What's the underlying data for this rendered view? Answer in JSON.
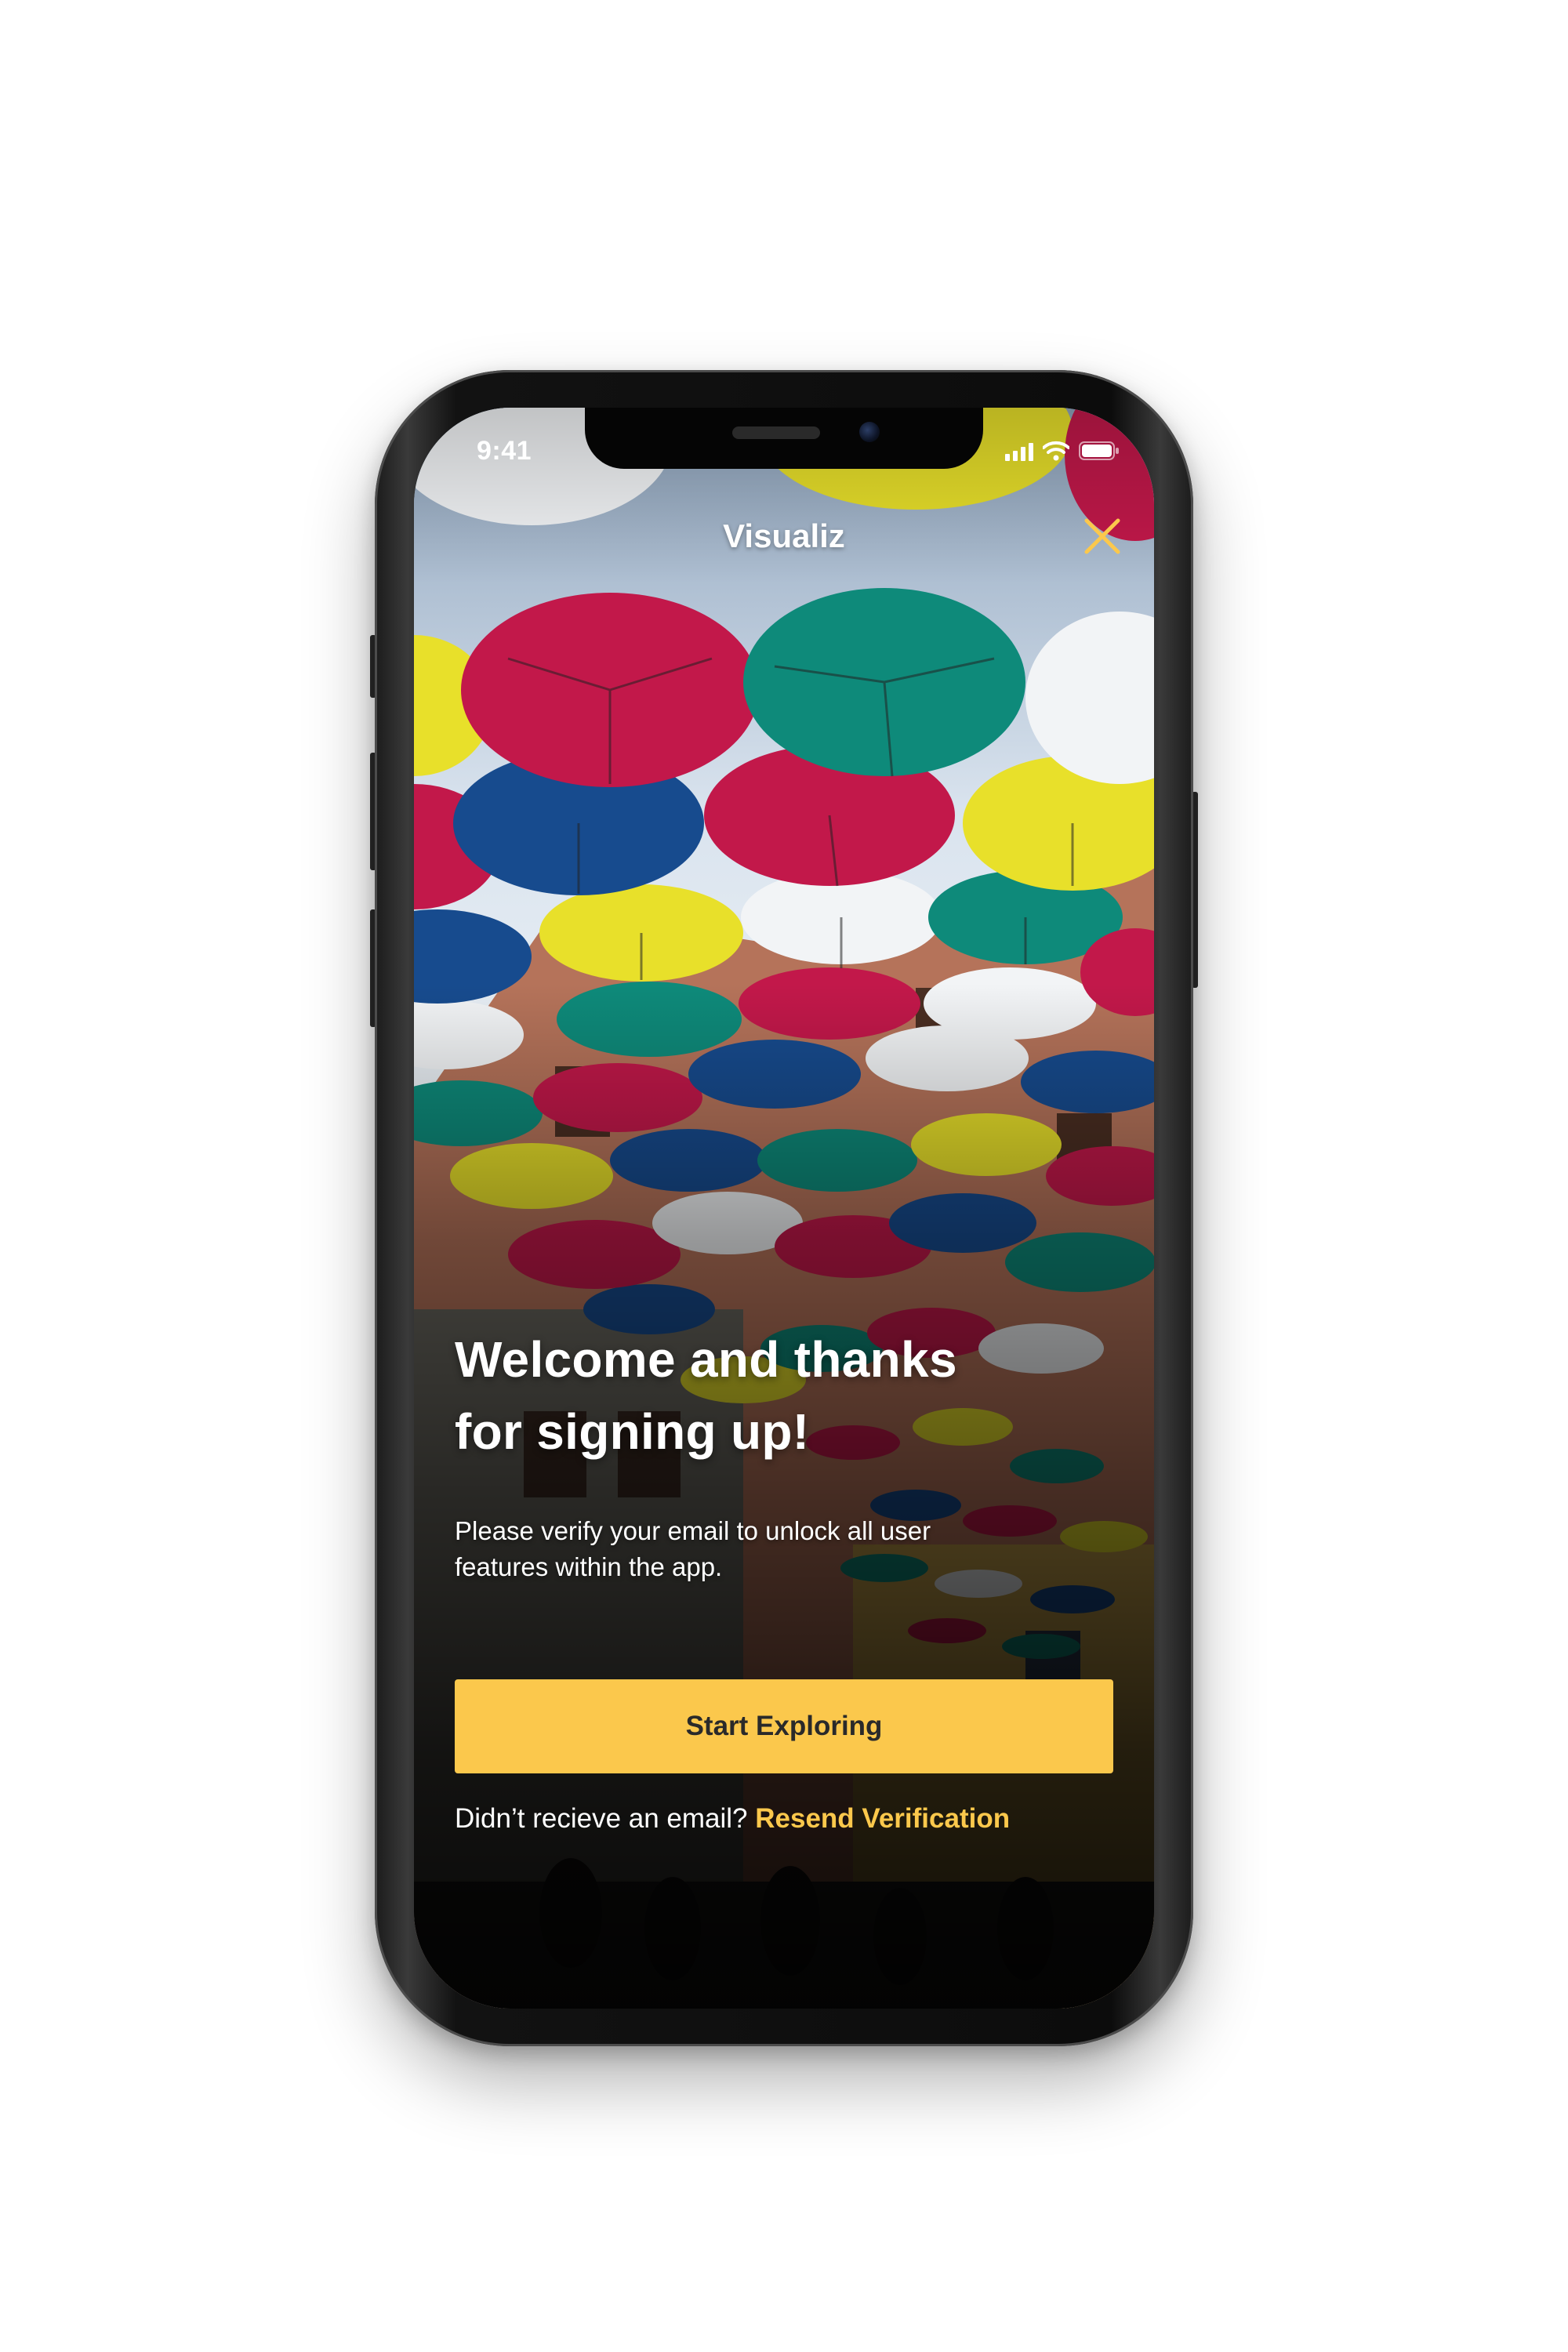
{
  "status_bar": {
    "time": "9:41",
    "icons": [
      "signal-icon",
      "wifi-icon",
      "battery-icon"
    ]
  },
  "header": {
    "app_name": "Visualiz",
    "close_icon": "close-icon"
  },
  "welcome": {
    "headline_line1": "Welcome and thanks",
    "headline_line2": "for signing up!",
    "line1": "Please verify your email to unlock all user",
    "line2": "features within the app."
  },
  "cta": {
    "label": "Start Exploring"
  },
  "resend": {
    "prompt": "Didn’t recieve an email?",
    "link": "Resend Verification"
  },
  "colors": {
    "accent": "#FBC84C",
    "text": "#FFFFFF",
    "button_text": "#2A2A2A"
  }
}
